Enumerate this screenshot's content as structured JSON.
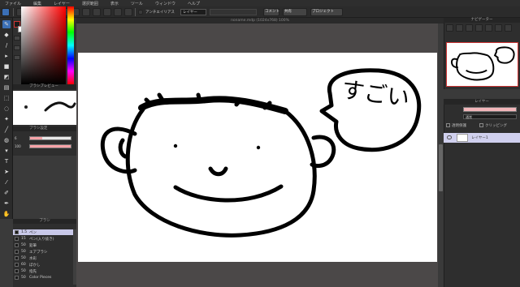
{
  "menu": [
    "ファイル",
    "編集",
    "レイヤー",
    "選択範囲",
    "表示",
    "ツール",
    "ウィンドウ",
    "ヘルプ"
  ],
  "toolbar": {
    "zoom": "100%",
    "antialias_label": "アンチエイリアス",
    "mode_value": "レイヤー",
    "comment_btn": "コメント",
    "share_btn": "共有",
    "project_btn": "プロジェクト"
  },
  "document_tab": "noname.mdp (1024x768) 100%",
  "panels": {
    "brush_preview_title": "ブラシプレビュー",
    "brush_settings_title": "ブラシ設定",
    "brush_size_value": "6",
    "brush_opacity_value": "100",
    "brush_list_title": "ブラシ",
    "navigator_title": "ナビゲーター",
    "layer_title": "レイヤー",
    "blend_mode": "通常",
    "protect_label": "透明保護",
    "clipping_label": "クリッピング",
    "layer_name": "レイヤー1",
    "layer_opacity": "100%"
  },
  "brush_list": [
    {
      "size": "1.5",
      "name": "ペン",
      "selected": true
    },
    {
      "size": "15",
      "name": "ペン(入り抜き)",
      "selected": false
    },
    {
      "size": "50",
      "name": "鉛筆",
      "selected": false
    },
    {
      "size": "50",
      "name": "エアブラシ",
      "selected": false
    },
    {
      "size": "50",
      "name": "水彩",
      "selected": false
    },
    {
      "size": "60",
      "name": "ぼかし",
      "selected": false
    },
    {
      "size": "50",
      "name": "指先",
      "selected": false
    },
    {
      "size": "50",
      "name": "Color Pieces",
      "selected": false
    }
  ],
  "canvas_text": "すごい",
  "colors": {
    "accent": "#3b6fb5",
    "selection": "#c9c9e9",
    "slider_fill": "#f6a3a8",
    "foreground": "#1b1b1b",
    "background": "#ffffff"
  }
}
